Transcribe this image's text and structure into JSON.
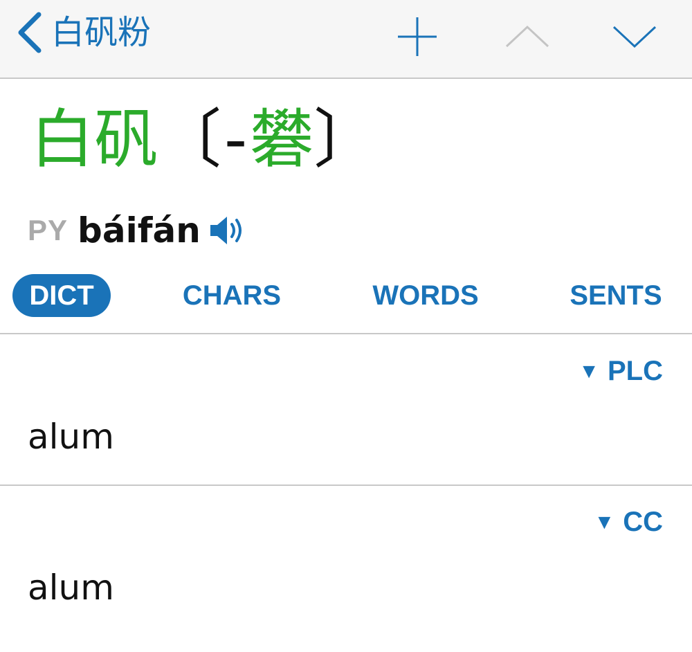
{
  "navbar": {
    "back_label": "白矾粉",
    "back_icon": "chevron-left-icon",
    "add_icon": "plus-icon",
    "prev_icon": "chevron-up-icon",
    "next_icon": "chevron-down-icon",
    "accent_color": "#1a73b8"
  },
  "entry": {
    "simplified": "白矾",
    "bracket_open": "〔",
    "dash": "-",
    "traditional_char": "礬",
    "bracket_close": "〕",
    "headword_color": "#2bab2b",
    "pinyin_tag": "PY",
    "pinyin": "báifán",
    "audio_icon": "speaker-icon"
  },
  "tabs": [
    {
      "label": "DICT",
      "active": true
    },
    {
      "label": "CHARS",
      "active": false
    },
    {
      "label": "WORDS",
      "active": false
    },
    {
      "label": "SENTS",
      "active": false
    }
  ],
  "sections": [
    {
      "source_marker": "▼",
      "source": "PLC",
      "definition": "alum"
    },
    {
      "source_marker": "▼",
      "source": "CC",
      "definition": "alum"
    }
  ]
}
